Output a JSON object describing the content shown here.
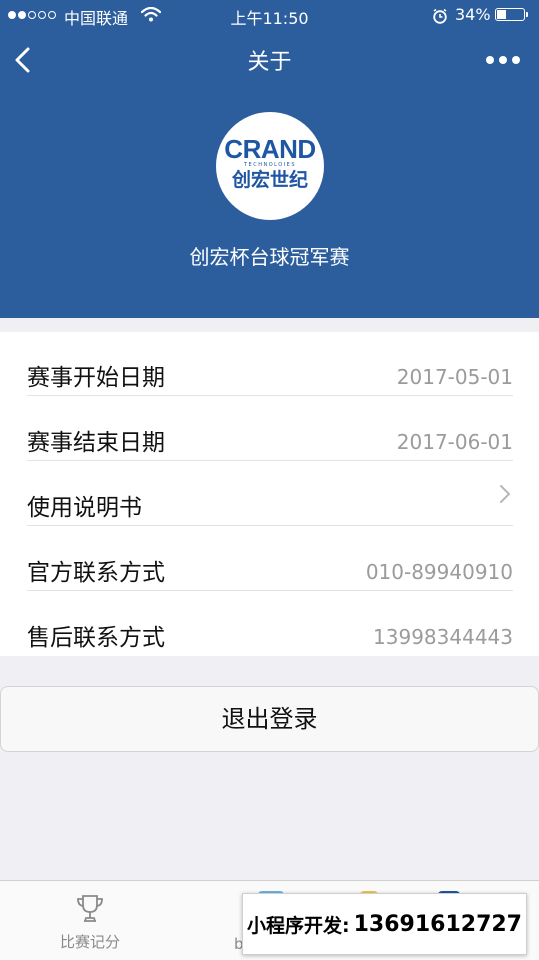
{
  "status_bar": {
    "carrier": "中国联通",
    "time": "上午11:50",
    "battery": "34%",
    "battery_level": 0.34
  },
  "nav": {
    "title": "关于",
    "back_icon": "chevron-left-icon",
    "more_icon": "more-dots-icon"
  },
  "header": {
    "logo": {
      "en": "CRAND",
      "sub": "TECHNOLOIES",
      "cn": "创宏世纪"
    },
    "event_name": "创宏杯台球冠军赛"
  },
  "info": {
    "rows": [
      {
        "label": "赛事开始日期",
        "value": "2017-05-01"
      },
      {
        "label": "赛事结束日期",
        "value": "2017-06-01"
      },
      {
        "label": "使用说明书",
        "value": ""
      },
      {
        "label": "官方联系方式",
        "value": "010-89940910"
      },
      {
        "label": "售后联系方式",
        "value": "13998344443"
      }
    ]
  },
  "logout": {
    "label": "退出登录"
  },
  "tabbar": {
    "score_label": "比赛记分",
    "partial_label": "b"
  },
  "promo": {
    "prefix": "小程序开发:",
    "phone": "13691612727"
  },
  "colors": {
    "header_bg": "#2c5e9e",
    "page_bg": "#efeff4",
    "logo_blue": "#1f56a3"
  }
}
